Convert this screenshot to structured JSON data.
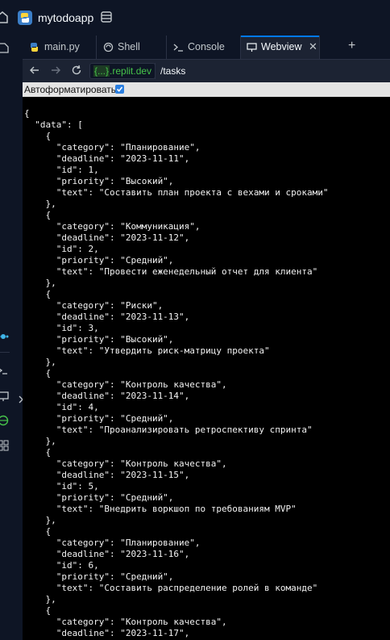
{
  "app": {
    "name": "mytodoapp"
  },
  "tabs": [
    {
      "label": "main.py",
      "icon": "python-icon"
    },
    {
      "label": "Shell",
      "icon": "shell-icon"
    },
    {
      "label": "Console",
      "icon": "console-icon"
    },
    {
      "label": "Webview",
      "icon": "monitor-icon",
      "active": true
    }
  ],
  "url": {
    "domain_braces": "{...}",
    "domain": ".replit.dev",
    "path": "/tasks"
  },
  "pretty_print": {
    "label": "Автоформатировать",
    "checked": true
  },
  "json_text": "{\n  \"data\": [\n    {\n      \"category\": \"Планирование\",\n      \"deadline\": \"2023-11-11\",\n      \"id\": 1,\n      \"priority\": \"Высокий\",\n      \"text\": \"Составить план проекта с вехами и сроками\"\n    },\n    {\n      \"category\": \"Коммуникация\",\n      \"deadline\": \"2023-11-12\",\n      \"id\": 2,\n      \"priority\": \"Средний\",\n      \"text\": \"Провести еженедельный отчет для клиента\"\n    },\n    {\n      \"category\": \"Риски\",\n      \"deadline\": \"2023-11-13\",\n      \"id\": 3,\n      \"priority\": \"Высокий\",\n      \"text\": \"Утвердить риск-матрицу проекта\"\n    },\n    {\n      \"category\": \"Контроль качества\",\n      \"deadline\": \"2023-11-14\",\n      \"id\": 4,\n      \"priority\": \"Средний\",\n      \"text\": \"Проанализировать ретроспективу спринта\"\n    },\n    {\n      \"category\": \"Контроль качества\",\n      \"deadline\": \"2023-11-15\",\n      \"id\": 5,\n      \"priority\": \"Средний\",\n      \"text\": \"Внедрить воркшоп по требованиям MVP\"\n    },\n    {\n      \"category\": \"Планирование\",\n      \"deadline\": \"2023-11-16\",\n      \"id\": 6,\n      \"priority\": \"Средний\",\n      \"text\": \"Составить распределение ролей в команде\"\n    },\n    {\n      \"category\": \"Контроль качества\",\n      \"deadline\": \"2023-11-17\",",
  "colors": {
    "accent": "#0079f2",
    "domain_green": "#46c34a",
    "background": "#0e1525"
  }
}
